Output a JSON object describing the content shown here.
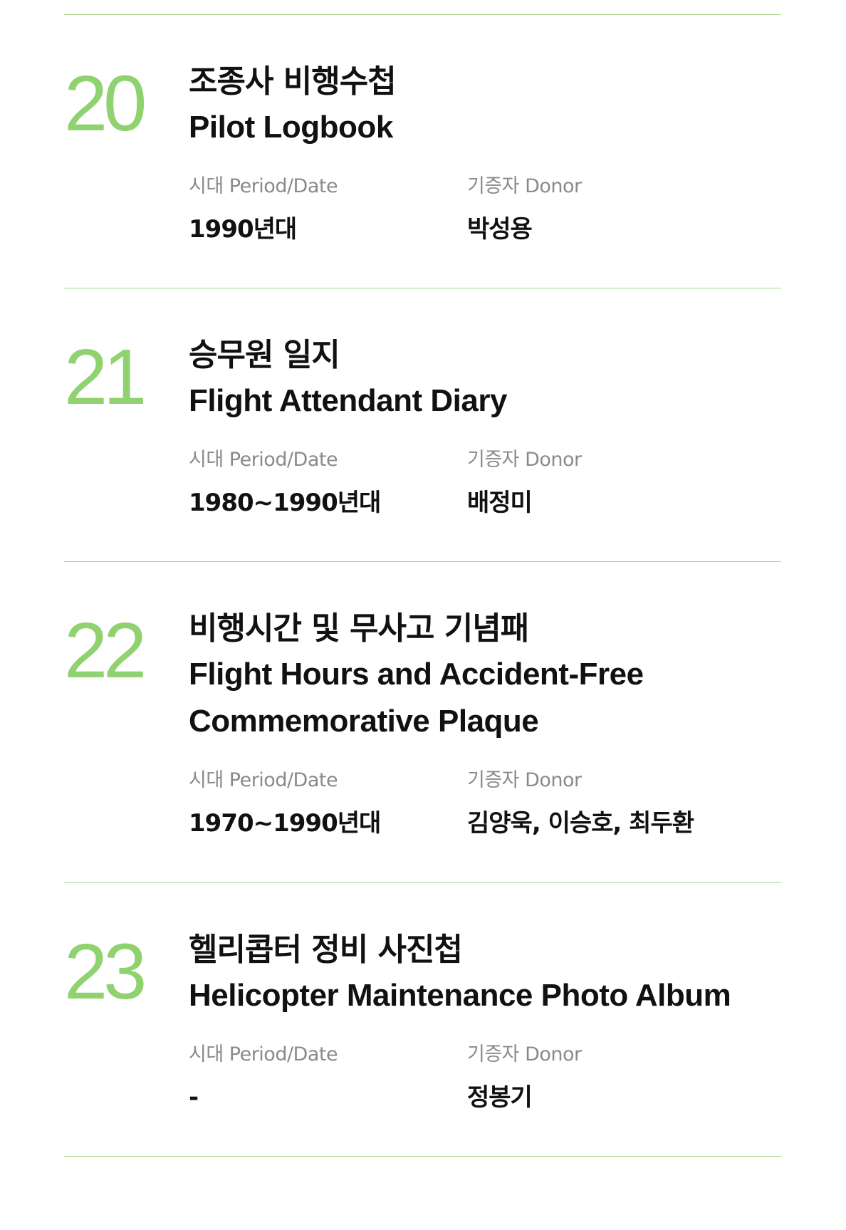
{
  "labels": {
    "period": "시대 Period/Date",
    "donor": "기증자 Donor"
  },
  "colors": {
    "accent": "#8fd26f",
    "divider": "#a9d98c",
    "label": "#8a8a8a",
    "text": "#111111"
  },
  "items": [
    {
      "number": "20",
      "title_ko": "조종사 비행수첩",
      "title_en_lines": [
        "Pilot Logbook"
      ],
      "period": "1990년대",
      "donor": "박성용"
    },
    {
      "number": "21",
      "title_ko": "승무원 일지",
      "title_en_lines": [
        "Flight Attendant Diary"
      ],
      "period": "1980~1990년대",
      "donor": "배정미"
    },
    {
      "number": "22",
      "title_ko": "비행시간 및 무사고 기념패",
      "title_en_lines": [
        "Flight Hours and Accident-Free",
        "Commemorative Plaque"
      ],
      "period": "1970~1990년대",
      "donor": "김양욱, 이승호, 최두환"
    },
    {
      "number": "23",
      "title_ko": "헬리콥터 정비 사진첩",
      "title_en_lines": [
        "Helicopter Maintenance Photo Album"
      ],
      "period": "-",
      "donor": "정봉기"
    }
  ]
}
